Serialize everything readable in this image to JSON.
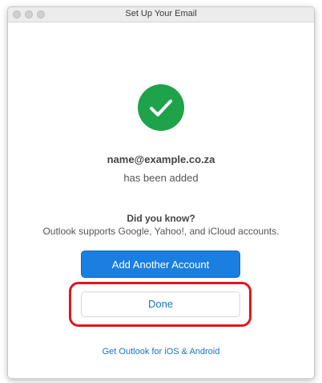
{
  "window": {
    "title": "Set Up Your Email"
  },
  "success": {
    "icon": "checkmark-icon",
    "color": "#1fa34a",
    "email": "name@example.co.za",
    "message": "has been added"
  },
  "tip": {
    "heading": "Did you know?",
    "text": "Outlook supports Google, Yahoo!, and iCloud accounts."
  },
  "buttons": {
    "add_account": "Add Another Account",
    "done": "Done"
  },
  "link": {
    "mobile": "Get Outlook for iOS & Android"
  },
  "colors": {
    "primary_button": "#1a7fe0",
    "link": "#1a72c9",
    "highlight": "#e3141e"
  }
}
